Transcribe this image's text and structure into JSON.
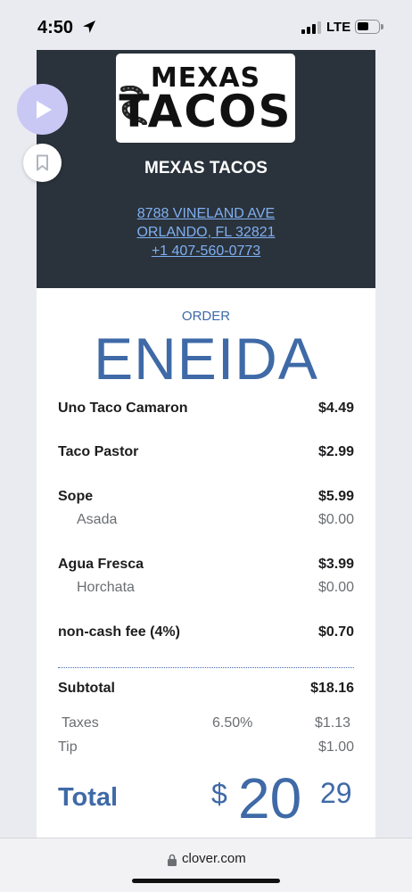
{
  "status_bar": {
    "time": "4:50",
    "network": "LTE"
  },
  "receipt": {
    "business_name": "MEXAS TACOS",
    "logo": {
      "word1": "MEXAS",
      "word2": "TACOS"
    },
    "address_line1": "8788 VINELAND AVE",
    "address_line2": "ORLANDO, FL 32821",
    "phone": "+1 407-560-0773",
    "order_label": "ORDER",
    "order_name": "ENEIDA",
    "items": [
      {
        "name": "Uno Taco Camaron",
        "price": "$4.49"
      },
      {
        "name": "Taco Pastor",
        "price": "$2.99"
      },
      {
        "name": "Sope",
        "price": "$5.99",
        "modifier": {
          "name": "Asada",
          "price": "$0.00"
        }
      },
      {
        "name": "Agua Fresca",
        "price": "$3.99",
        "modifier": {
          "name": "Horchata",
          "price": "$0.00"
        }
      },
      {
        "name": "non-cash fee (4%)",
        "price": "$0.70"
      }
    ],
    "subtotal_label": "Subtotal",
    "subtotal": "$18.16",
    "taxes_label": "Taxes",
    "tax_rate": "6.50%",
    "taxes": "$1.13",
    "tip_label": "Tip",
    "tip": "$1.00",
    "total_label": "Total",
    "total_currency": "$",
    "total_major": "20",
    "total_minor": "29"
  },
  "browser": {
    "url": "clover.com"
  },
  "icons": {
    "play": "play-icon",
    "bookmark": "bookmark-icon",
    "lock": "lock-icon",
    "location": "location-arrow-icon",
    "signal": "cellular-signal-icon",
    "battery": "battery-icon"
  },
  "colors": {
    "header_bg": "#2a323b",
    "accent_blue": "#3f6aa7",
    "link_blue": "#7fb0f2",
    "play_button_bg": "#c9c8f5"
  }
}
